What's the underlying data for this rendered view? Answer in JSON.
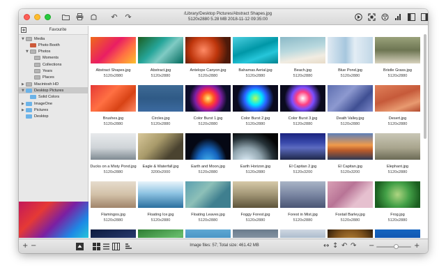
{
  "window": {
    "path": "/Library/Desktop Pictures/Abstract Shapes.jpg",
    "info": "5120x2880  5.28 MB  2018-11-12 09:35:00"
  },
  "sidebar": {
    "header": "Favourite",
    "tree": [
      {
        "label": "Media",
        "arrow": "▼",
        "icon": "grey"
      },
      {
        "label": "Photo Booth",
        "arrow": "",
        "icon": "red"
      },
      {
        "label": "Photos",
        "arrow": "▼",
        "icon": "grey"
      },
      {
        "label": "Moments",
        "arrow": "",
        "icon": "grey"
      },
      {
        "label": "Collections",
        "arrow": "",
        "icon": "grey"
      },
      {
        "label": "Years",
        "arrow": "",
        "icon": "grey"
      },
      {
        "label": "Places",
        "arrow": "",
        "icon": "grey"
      },
      {
        "label": "Macintosh HD",
        "arrow": "▶",
        "icon": "grey"
      },
      {
        "label": "Desktop Pictures",
        "arrow": "▼",
        "icon": "blue"
      },
      {
        "label": "Solid Colors",
        "arrow": "",
        "icon": "blue"
      },
      {
        "label": "ImageOne",
        "arrow": "▶",
        "icon": "blue"
      },
      {
        "label": "Pictures",
        "arrow": "▶",
        "icon": "blue"
      },
      {
        "label": "Desktop",
        "arrow": "",
        "icon": "blue"
      }
    ]
  },
  "images": [
    {
      "name": "Abstract Shapes.jpg",
      "dims": "5120x2880",
      "grad": "linear-gradient(135deg,#f06a1a,#e91e63 45%,#ff7043 70%,#fbc02d)"
    },
    {
      "name": "Abstract.jpg",
      "dims": "5120x2880",
      "grad": "linear-gradient(135deg,#1b5e20,#26a69a 40%,#80cbc4 60%,#00695c)"
    },
    {
      "name": "Antelope Canyon.jpg",
      "dims": "5120x2880",
      "grad": "radial-gradient(circle at 40% 50%,#ff8a65,#bf360c 45%,#4e1a0a 80%)"
    },
    {
      "name": "Bahamas Aerial.jpg",
      "dims": "5120x2880",
      "grad": "linear-gradient(160deg,#4dd0e1,#0097a7 45%,#26c6da 70%,#00838f)"
    },
    {
      "name": "Beach.jpg",
      "dims": "5120x2880",
      "grad": "linear-gradient(170deg,#8bb9c7,#b8d8de 45%,#f1ece2 75%,#e8dcc8)"
    },
    {
      "name": "Blue Pond.jpg",
      "dims": "5120x2880",
      "grad": "linear-gradient(90deg,#dfeaf3,#a7c7de 40%,#e3edf5 60%,#c1d7e6)"
    },
    {
      "name": "Bristle Grass.jpg",
      "dims": "5120x2880",
      "grad": "linear-gradient(180deg,#9aa27b,#6d7552 50%,#d7d2bd)"
    },
    {
      "name": "Brushes.jpg",
      "dims": "5120x2880",
      "grad": "linear-gradient(135deg,#e53935,#ff7043 40%,#d84315 70%,#ff8a65)"
    },
    {
      "name": "Circles.jpg",
      "dims": "5120x2880",
      "grad": "linear-gradient(180deg,#3e6a95,#2f5a86 50%,#3b6aa0)"
    },
    {
      "name": "Color Burst 1.jpg",
      "dims": "5120x2880",
      "grad": "radial-gradient(circle at 50% 50%,#fff176,#ff5722 22%,#e91e63 35%,#7b1fa2 50%,#0d0d2a 72%)"
    },
    {
      "name": "Color Burst 2.jpg",
      "dims": "5120x2880",
      "grad": "radial-gradient(circle at 50% 50%,#b2ff59,#00e5ff 25%,#2962ff 42%,#0a0a1e 70%)"
    },
    {
      "name": "Color Burst 3.jpg",
      "dims": "5120x2880",
      "grad": "radial-gradient(circle at 50% 50%,#ffffff,#ff4081 25%,#7c4dff 42%,#0a0a1e 70%)"
    },
    {
      "name": "Death Valley.jpg",
      "dims": "5120x2880",
      "grad": "linear-gradient(135deg,#5e6fb0,#8d99d0 40%,#3f4f93 70%,#7b88c8)"
    },
    {
      "name": "Desert.jpg",
      "dims": "5120x2880",
      "grad": "linear-gradient(160deg,#e0805a,#c65a3a 45%,#e89a70 75%,#b34a2e)"
    },
    {
      "name": "Ducks on a Misty Pond.jpg",
      "dims": "5120x2880",
      "grad": "linear-gradient(180deg,#e8eaec,#cfd4d8 55%,#7f8a92)"
    },
    {
      "name": "Eagle & Waterfall.jpg",
      "dims": "3200x2000",
      "grad": "linear-gradient(135deg,#d8c79a,#a89a6a 40%,#4a4330 75%)"
    },
    {
      "name": "Earth and Moon.jpg",
      "dims": "5120x2880",
      "grad": "radial-gradient(ellipse at 50% 120%,#4fc3f7,#1565c0 35%,#050814 60%)"
    },
    {
      "name": "Earth Horizon.jpg",
      "dims": "5120x2880",
      "grad": "radial-gradient(ellipse at 30% 110%,#e3f2fd,#90a4ae 35%,#263238 60%,#050505 80%)"
    },
    {
      "name": "El Capitan 2.jpg",
      "dims": "5120x3200",
      "grad": "linear-gradient(180deg,#1a237e,#3949ab 35%,#5c6bc0 55%,#1e2748)"
    },
    {
      "name": "El Capitan.jpg",
      "dims": "5120x3200",
      "grad": "linear-gradient(180deg,#5c7fb8,#f09a4a 45%,#b95a2a 65%,#2e3a55)"
    },
    {
      "name": "Elephant.jpg",
      "dims": "5120x2880",
      "grad": "linear-gradient(180deg,#c9c7b6,#a9a58e 55%,#6b6a55)"
    },
    {
      "name": "Flamingos.jpg",
      "dims": "5120x2880",
      "grad": "linear-gradient(180deg,#e6dccd,#d2c1a8 50%,#a0846a)"
    },
    {
      "name": "Floating Ice.jpg",
      "dims": "5120x2880",
      "grad": "linear-gradient(180deg,#e8f4fb,#8ec3e2 45%,#2a6f9e)"
    },
    {
      "name": "Floating Leaves.jpg",
      "dims": "5120x2880",
      "grad": "linear-gradient(135deg,#5a9fb0,#8dc0b8 40%,#3f7f8f 70%)"
    },
    {
      "name": "Foggy Forest.jpg",
      "dims": "5120x2880",
      "grad": "linear-gradient(180deg,#d6c9a8,#a19575 50%,#5c5339)"
    },
    {
      "name": "Forest in Mist.jpg",
      "dims": "5120x2880",
      "grad": "linear-gradient(180deg,#a9b4c6,#7a86a2 50%,#4a5574)"
    },
    {
      "name": "Foxtail Barley.jpg",
      "dims": "5120x2880",
      "grad": "linear-gradient(135deg,#d9a0b5,#b87496 40%,#e6c0cf 70%)"
    },
    {
      "name": "Frog.jpg",
      "dims": "5120x2880",
      "grad": "radial-gradient(circle at 50% 50%,#aed581,#43a047 45%,#1b5e20 85%)"
    },
    {
      "name": "",
      "dims": "",
      "grad": "linear-gradient(160deg,#0d1b3e,#283a6e 60%,#1a2a55)"
    },
    {
      "name": "",
      "dims": "",
      "grad": "linear-gradient(160deg,#2e7d32,#66bb6a 50%,#1b5e20)"
    },
    {
      "name": "",
      "dims": "",
      "grad": "linear-gradient(180deg,#5fa8d3,#2f7fb5 70%)"
    },
    {
      "name": "",
      "dims": "",
      "grad": "linear-gradient(180deg,#6a7b8c,#9aa7b4 60%,#3d4a56)"
    },
    {
      "name": "",
      "dims": "",
      "grad": "linear-gradient(180deg,#cfd8e3,#8ea2b8 60%)"
    },
    {
      "name": "",
      "dims": "",
      "grad": "radial-gradient(circle at 50% 60%,#c8913d,#7a4f1c 60%,#2d1c0b)"
    },
    {
      "name": "",
      "dims": "",
      "grad": "linear-gradient(180deg,#1565c0,#0d47a1 70%)"
    }
  ],
  "status": "Image files: 57;  Total size: 461.42 MB",
  "colors": {
    "close": "#fd5f57",
    "minimize": "#febc2e",
    "zoom": "#29c940"
  }
}
